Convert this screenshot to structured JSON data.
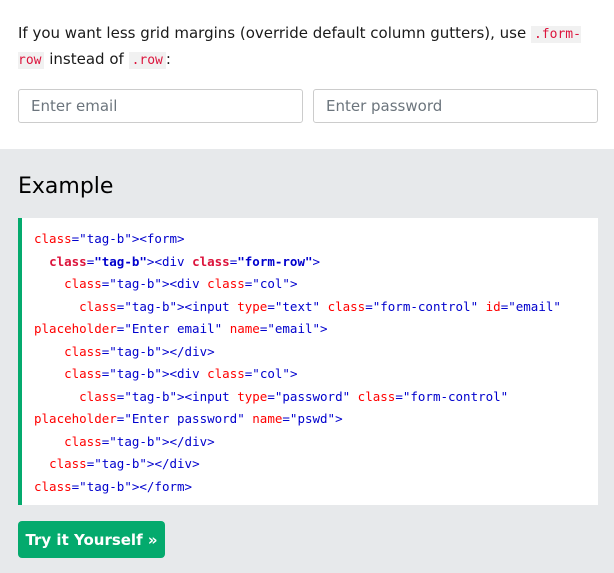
{
  "intro": {
    "text_before": "If you want less grid margins (override default column gutters), use ",
    "code1": ".form-row",
    "text_mid": " instead of ",
    "code2": ".row",
    "text_after": ":"
  },
  "form": {
    "email_placeholder": "Enter email",
    "password_placeholder": "Enter password"
  },
  "example": {
    "title": "Example",
    "code_lines": [
      "<form>",
      "  <div class=\"form-row\">",
      "    <div class=\"col\">",
      "      <input type=\"text\" class=\"form-control\" id=\"email\" placeholder=\"Enter email\" name=\"email\">",
      "    </div>",
      "    <div class=\"col\">",
      "      <input type=\"password\" class=\"form-control\" placeholder=\"Enter password\" name=\"pswd\">",
      "    </div>",
      "  </div>",
      "</form>"
    ],
    "try_button_label": "Try it Yourself »"
  },
  "colors": {
    "accent": "#04aa6d",
    "example_bg": "#e7e9eb",
    "code_highlight": "#dc143c"
  }
}
